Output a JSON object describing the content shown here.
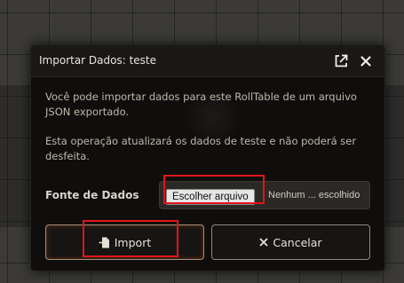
{
  "dialog": {
    "title": "Importar Dados: teste",
    "icons": {
      "popout": "external-link-icon",
      "close": "close-icon"
    },
    "paragraph_1": "Você pode importar dados para este RollTable de um arquivo JSON exportado.",
    "paragraph_2": "Esta operação atualizará os dados de teste e não poderá ser desfeita.",
    "field_label": "Fonte de Dados",
    "file_button_label": "Escolher arquivo",
    "file_status": "Nenhum ... escolhido",
    "import_label": "Import",
    "import_icon": "file-import-icon",
    "cancel_label": "Cancelar",
    "cancel_icon": "times-icon"
  },
  "colors": {
    "highlight": "#e0141b",
    "dialog_bg": "#0f0e0c",
    "button_border": "#8e8a82"
  }
}
